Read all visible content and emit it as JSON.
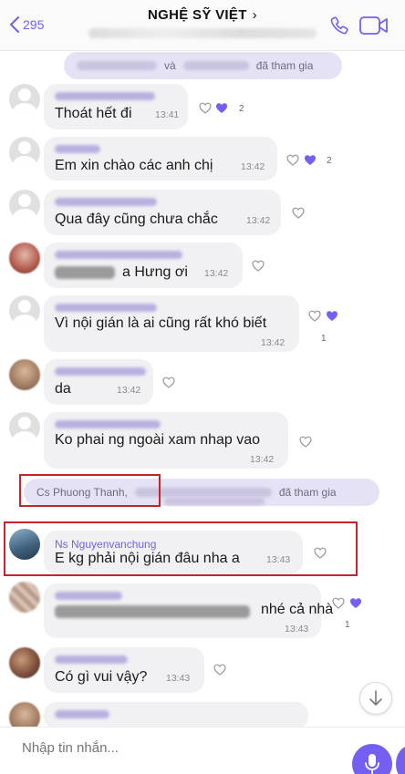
{
  "header": {
    "back_count": "295",
    "title": "NGHỆ SỸ VIỆT",
    "title_chevron": "›",
    "icons": [
      "call-icon",
      "video-call-icon"
    ]
  },
  "system": {
    "joined_1_connector": "và",
    "joined_1_suffix": "đã tham gia",
    "joined_2_name": "Cs Phuong Thanh,",
    "joined_2_suffix": "đã tham gia"
  },
  "messages": [
    {
      "text": "Thoát hết đi",
      "time": "13:41",
      "reactions": "2"
    },
    {
      "text": "Em xin chào các anh chị",
      "time": "13:42",
      "reactions": "2"
    },
    {
      "text": "Qua đây cũng chưa chắc",
      "time": "13:42"
    },
    {
      "text": "a Hưng ơi",
      "time": "13:42"
    },
    {
      "text": "Vì nội gián là ai cũng rất khó biết",
      "time": "13:42",
      "reactions": "1"
    },
    {
      "text": "da",
      "time": "13:42"
    },
    {
      "text": "Ko phai ng ngoài xam nhap vao",
      "time": "13:42"
    },
    {
      "sender": "Ns Nguyenvanchung",
      "text": "E kg phải nội gián đâu nha a",
      "time": "13:43"
    },
    {
      "text": "nhé cả nhà",
      "time": "13:43",
      "reactions": "1"
    },
    {
      "text": "Có gì vui vậy?",
      "time": "13:43"
    }
  ],
  "composer": {
    "placeholder": "Nhập tin nhắn..."
  },
  "colors": {
    "accent": "#7360f2",
    "bubble": "#f1f1f3",
    "system_pill": "#e6e2f5",
    "highlight": "#c4242a"
  }
}
